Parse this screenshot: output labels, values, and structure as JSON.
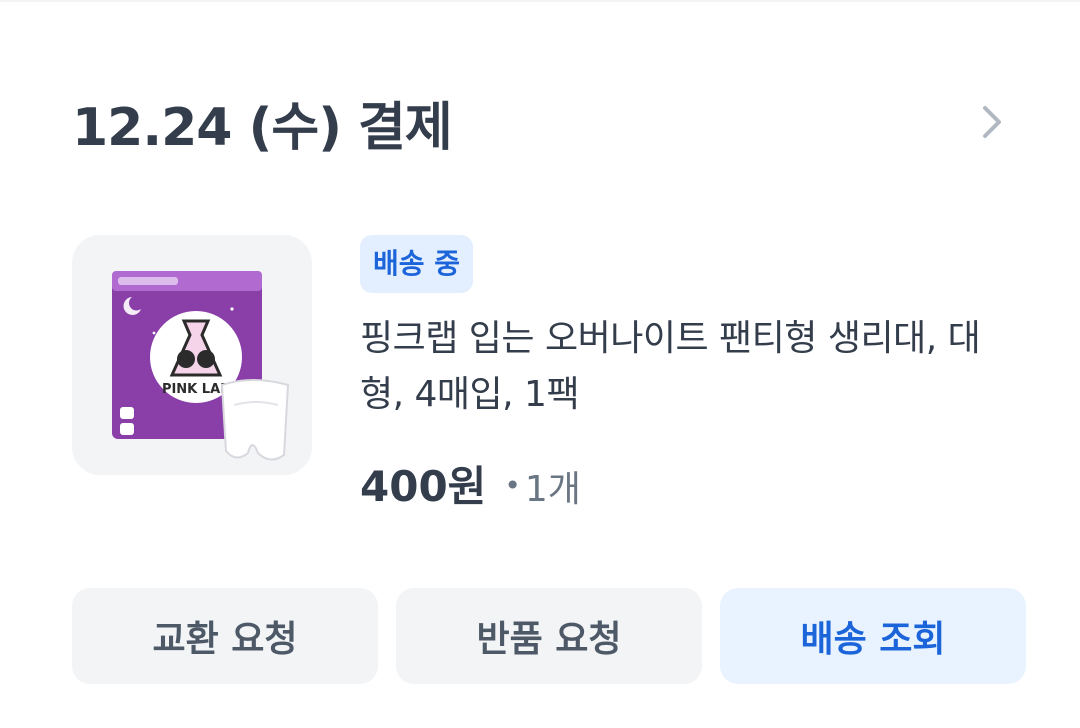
{
  "header": {
    "title": "12.24 (수) 결제",
    "chevron_icon": "chevron-right-icon"
  },
  "product": {
    "image_alt": "PINK LAB",
    "status_badge": "배송 중",
    "name": "핑크랩 입는 오버나이트 팬티형 생리대, 대형, 4매입, 1팩",
    "price": "400원",
    "quantity": "1개"
  },
  "actions": {
    "exchange_label": "교환 요청",
    "return_label": "반품 요청",
    "tracking_label": "배송 조회"
  },
  "colors": {
    "title_text": "#333d4b",
    "badge_bg": "#e3efff",
    "badge_text": "#1b64da",
    "button_bg": "#f2f4f6",
    "primary_button_bg": "#e8f3ff",
    "primary_button_text": "#1b64da"
  }
}
